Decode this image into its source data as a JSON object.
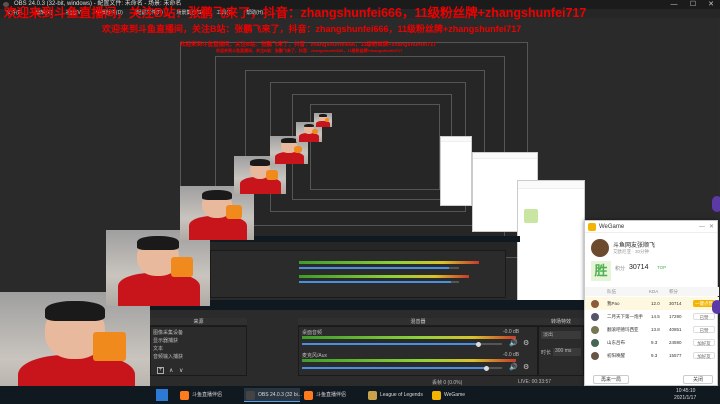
{
  "window": {
    "title": "OBS 24.0.3 (32-bit, windows) - 配置文件: 未命名 - 场景: 未命名",
    "minimize_glyph": "—",
    "maximize_glyph": "☐",
    "close_glyph": "✕"
  },
  "menu": [
    "文件(F)",
    "编辑(E)",
    "视图(V)",
    "停靠部件(D)",
    "配置文件(P)",
    "场景集合(S)",
    "工具(T)",
    "帮助(H)"
  ],
  "overlay": {
    "line1": "欢迎来到斗鱼直播间，关注B站：张鹏飞来了，抖音：zhangshunfei666，11级粉丝牌+zhangshunfei717",
    "line2": "欢迎来到斗鱼直播间，关注B站：张鹏飞来了，抖音：zhangshunfei666，11级粉丝牌+zhangshunfei717",
    "line3": "欢迎来到斗鱼直播间，关注B站：张鹏飞来了，抖音：zhangshunfei666，11级粉丝牌+zhangshunfei717",
    "line4": "欢迎来到斗鱼直播间，关注B站：张鹏飞来了，抖音：zhangshunfei666，11级粉丝牌+zhangshunfei717"
  },
  "docks": {
    "scenes": "来源",
    "mixer": "混音器",
    "transitions": "转场特效",
    "controls": "控制"
  },
  "sources": [
    "图像采集设备",
    "显示器捕获",
    "文本",
    "音频输入捕获"
  ],
  "mixer": {
    "track1": {
      "name": "桌面音频",
      "db": "-0.0 dB",
      "level": 0.88
    },
    "track2": {
      "name": "麦克风/Aux",
      "db": "-0.0 dB",
      "level": 0.92
    }
  },
  "transition": {
    "name": "淡出",
    "duration_label": "时长",
    "duration": "300 ms"
  },
  "controls": [
    "开始推流",
    "停止录制",
    "工作室模式",
    "设置",
    "退出"
  ],
  "statusbar": {
    "dropped": "丢帧 0 (0.0%)",
    "live": "LIVE: 00:33:57",
    "rec": "REC: 00:00:00",
    "cpu": "CPU: 12.0%, 60.00 fps",
    "kbps": "kb/s: 3502"
  },
  "taskbar": {
    "tasks": [
      {
        "label": "斗鱼直播伴侣",
        "color": "#ff7a1a"
      },
      {
        "label": "OBS 24.0.3 (32 bi...",
        "color": "#444444"
      },
      {
        "label": "斗鱼直播伴侣",
        "color": "#ff7a1a"
      },
      {
        "label": "League of Legends",
        "color": "#c8a34a"
      },
      {
        "label": "WeGame",
        "color": "#f4b400"
      }
    ],
    "time": "10:45:10",
    "date": "2021/1/17"
  },
  "wegame": {
    "title": "WeGame",
    "user": {
      "name": "斗鱼网友张顺飞",
      "rank": "艾欧尼亚 · 30分钟"
    },
    "result": "胜",
    "score_label": "积分",
    "score": "30714",
    "tag": "TOP",
    "tabs": [
      "队伍",
      "KDA",
      "积分"
    ],
    "players": [
      {
        "name": "我Pao",
        "kda": "12.0",
        "score": "30714",
        "action": "一键点赞",
        "highlight": true
      },
      {
        "name": "二月天下第一炮手",
        "kda": "14.5",
        "score": "17290",
        "action": "已赞",
        "highlight": false
      },
      {
        "name": "翻滚吧德玛西亚",
        "kda": "13.8",
        "score": "40851",
        "action": "已赞",
        "highlight": false
      },
      {
        "name": "山东吕布",
        "kda": "9.3",
        "score": "24590",
        "action": "加好友",
        "highlight": false
      },
      {
        "name": "初阳唤醒",
        "kda": "9.3",
        "score": "15577",
        "action": "加好友",
        "highlight": false
      }
    ],
    "btn_left": "再来一局",
    "btn_right": "关闭"
  },
  "colors": {
    "accent": "#4a90e2",
    "overlay_text": "#e00000",
    "wegame_yellow": "#f4b400",
    "meter_green": "#3d9c2c"
  }
}
